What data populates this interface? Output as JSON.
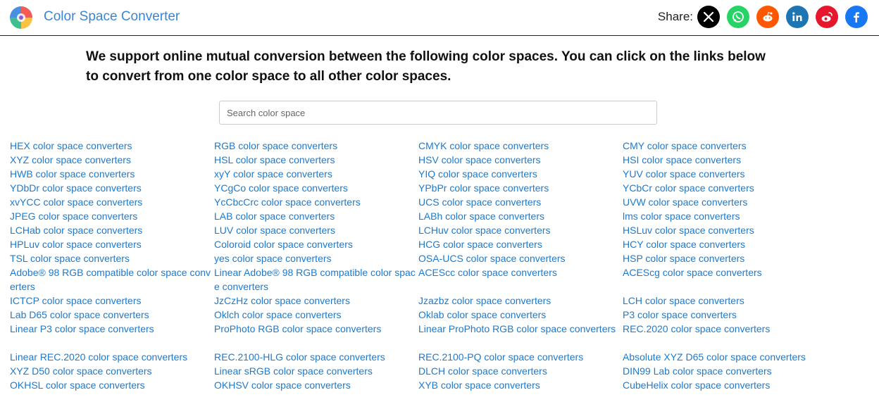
{
  "header": {
    "brand": "Color Space Converter",
    "share_label": "Share:",
    "share_buttons": [
      {
        "name": "x-icon",
        "color": "#000000"
      },
      {
        "name": "whatsapp-icon",
        "color": "#25d366"
      },
      {
        "name": "reddit-icon",
        "color": "#ff5700"
      },
      {
        "name": "linkedin-icon",
        "color": "#1d75b3"
      },
      {
        "name": "weibo-icon",
        "color": "#e6162d"
      },
      {
        "name": "facebook-icon",
        "color": "#1877f2"
      }
    ]
  },
  "intro": "We support online mutual conversion between the following color spaces. You can click on the links below to convert from one color space to all other color spaces.",
  "search": {
    "placeholder": "Search color space",
    "value": ""
  },
  "links": {
    "c1": [
      "HEX color space converters",
      "XYZ color space converters",
      "HWB color space converters",
      "YDbDr color space converters",
      "xvYCC color space converters",
      "JPEG color space converters",
      "LCHab color space converters",
      "HPLuv color space converters",
      "TSL color space converters",
      "Adobe® 98 RGB compatible color space converters",
      "ICTCP color space converters",
      "Lab D65 color space converters",
      "Linear P3 color space converters",
      "Linear REC.2020 color space converters",
      "XYZ D50 color space converters",
      "OKHSL color space converters"
    ],
    "c2": [
      "RGB color space converters",
      "HSL color space converters",
      "xyY color space converters",
      "YCgCo color space converters",
      "YcCbcCrc color space converters",
      "LAB color space converters",
      "LUV color space converters",
      "Coloroid color space converters",
      "yes color space converters",
      "Linear Adobe® 98 RGB compatible color space converters",
      "JzCzHz color space converters",
      "Oklch color space converters",
      "ProPhoto RGB color space converters",
      "REC.2100-HLG color space converters",
      "Linear sRGB color space converters",
      "OKHSV color space converters"
    ],
    "c3": [
      "CMYK color space converters",
      "HSV color space converters",
      "YIQ color space converters",
      "YPbPr color space converters",
      "UCS color space converters",
      "LABh color space converters",
      "LCHuv color space converters",
      "HCG color space converters",
      "OSA-UCS color space converters",
      "ACEScc color space converters",
      "Jzazbz color space converters",
      "Oklab color space converters",
      "Linear ProPhoto RGB color space converters",
      "REC.2100-PQ color space converters",
      "DLCH color space converters",
      "XYB color space converters"
    ],
    "c4": [
      "CMY color space converters",
      "HSI color space converters",
      "YUV color space converters",
      "YCbCr color space converters",
      "UVW color space converters",
      "lms color space converters",
      "HSLuv color space converters",
      "HCY color space converters",
      "HSP color space converters",
      "ACEScg color space converters",
      "LCH color space converters",
      "P3 color space converters",
      "REC.2020 color space converters",
      "Absolute XYZ D65 color space converters",
      "DIN99 Lab color space converters",
      "CubeHelix color space converters"
    ]
  }
}
